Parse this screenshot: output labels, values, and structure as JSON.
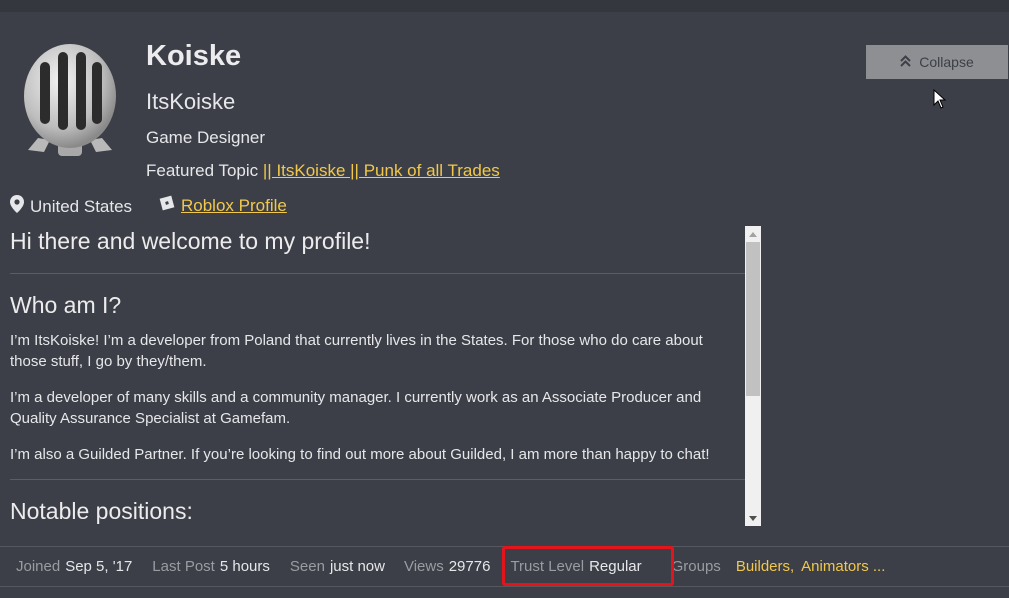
{
  "profile": {
    "name": "Koiske",
    "username": "ItsKoiske",
    "title": "Game Designer",
    "featured_label": "Featured Topic",
    "featured_link": "|| ItsKoiske || Punk of all Trades",
    "location": "United States",
    "roblox_link": "Roblox Profile"
  },
  "collapse": {
    "label": "Collapse"
  },
  "bio": {
    "heading_welcome": "Hi there and welcome to my profile!",
    "heading_who": "Who am I?",
    "para1": "I’m ItsKoiske! I’m a developer from Poland that currently lives in the States. For those who do care about those stuff, I go by they/them.",
    "para2": "I’m a developer of many skills and a community manager. I currently work as an Associate Producer and Quality Assurance Specialist at Gamefam.",
    "para3": "I’m also a Guilded Partner. If you’re looking to find out more about Guilded, I am more than happy to chat!",
    "heading_notable": "Notable positions:"
  },
  "stats": {
    "joined_label": "Joined",
    "joined_value": "Sep 5, '17",
    "last_post_label": "Last Post",
    "last_post_value": "5 hours",
    "seen_label": "Seen",
    "seen_value": "just now",
    "views_label": "Views",
    "views_value": "29776",
    "trust_label": "Trust Level",
    "trust_value": "Regular",
    "groups_label": "Groups",
    "groups": [
      "Builders,",
      "Animators ..."
    ]
  },
  "colors": {
    "background": "#3c3f47",
    "link": "#f1c84b",
    "highlight": "#e3141b",
    "button": "#8d8f93"
  }
}
